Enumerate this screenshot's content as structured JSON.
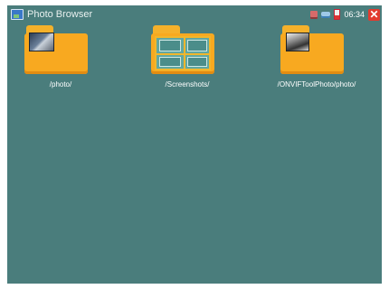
{
  "app": {
    "title": "Photo Browser"
  },
  "status": {
    "time": "06:34",
    "close_symbol": "✕"
  },
  "folders": [
    {
      "label": "/photo/",
      "thumbnail": "photo-thumbnail"
    },
    {
      "label": "/Screenshots/",
      "thumbnail": "screenshots-thumbnail"
    },
    {
      "label": "/ONVIFToolPhoto/photo/",
      "thumbnail": "onvif-photo-thumbnail"
    }
  ],
  "colors": {
    "background": "#4a7d7c",
    "folder": "#f8a920",
    "close_button": "#e23b2f"
  }
}
